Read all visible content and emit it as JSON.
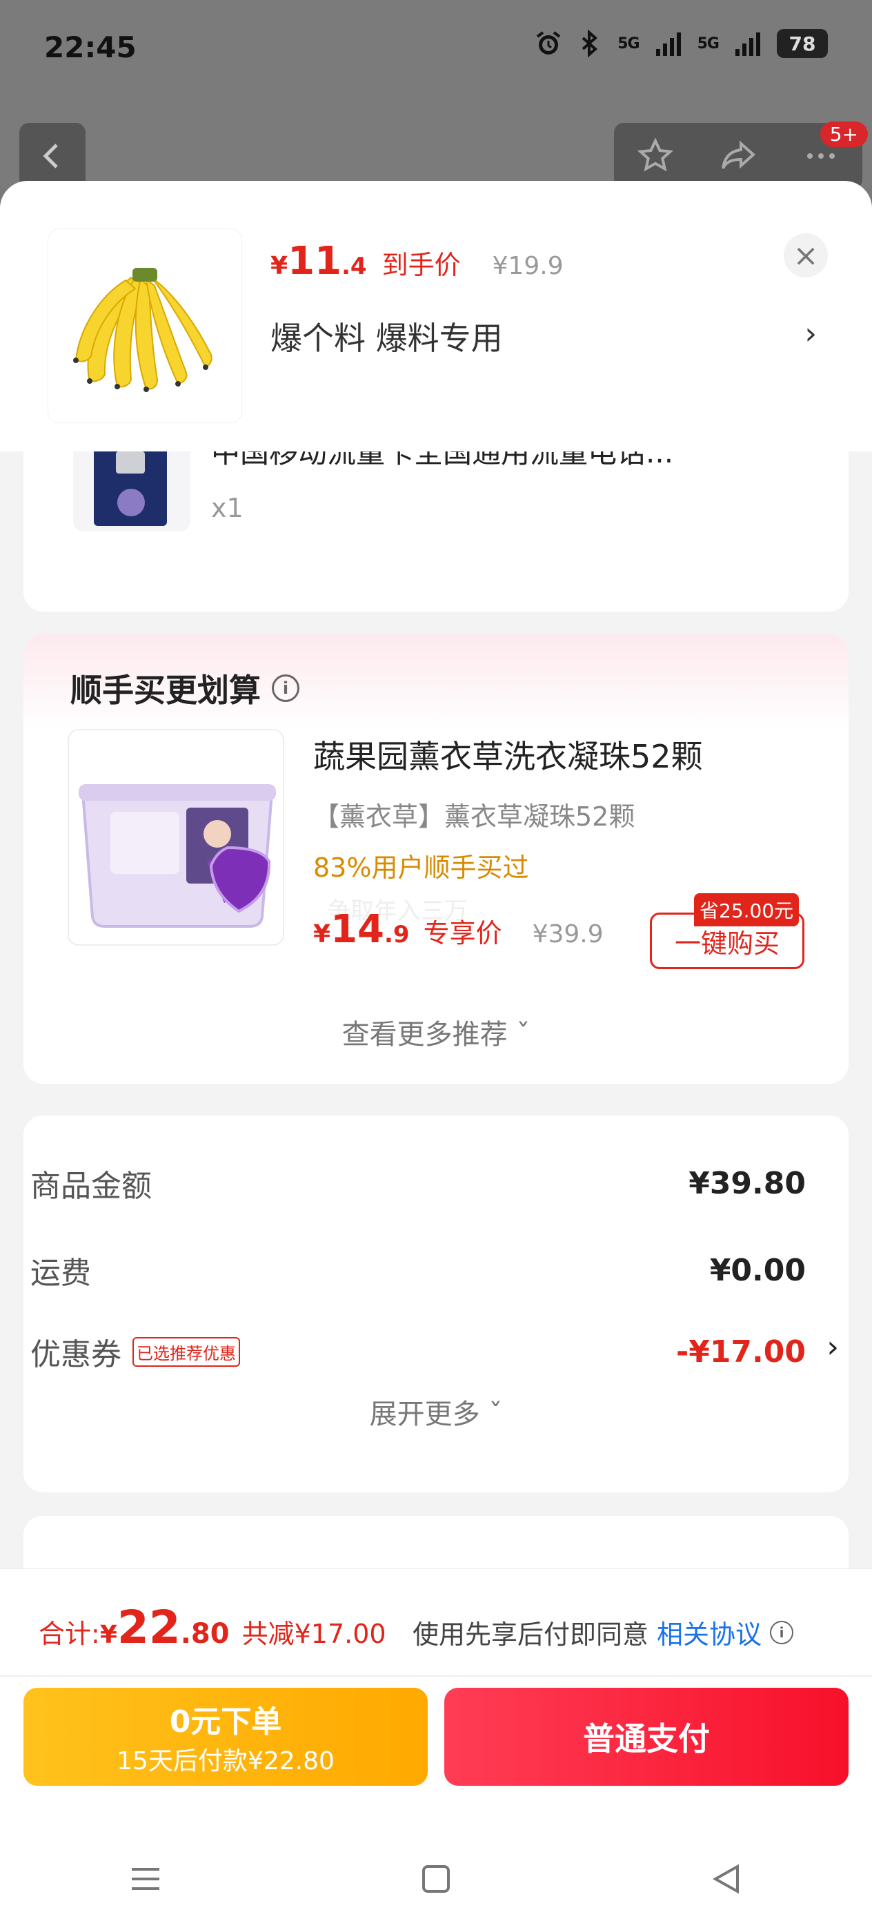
{
  "status_bar": {
    "time": "22:45",
    "signal1": "5G",
    "signal2": "5G",
    "battery": "78"
  },
  "top_nav": {
    "notif_badge": "5+"
  },
  "header": {
    "price_yen": "¥",
    "price_int": "11",
    "price_cents": ".4",
    "price_label": "到手价",
    "original_price": "¥19.9",
    "spec": "爆个料  爆料专用",
    "spec_arrow": "›",
    "close": "×"
  },
  "item": {
    "title": "中国移动流量卡全国通用流量电话...",
    "qty": "x1"
  },
  "recommend": {
    "title": "顺手买更划算",
    "info": "i",
    "product_name": "蔬果园薰衣草洗衣凝珠52颗",
    "product_spec": "【薰衣草】薰衣草凝珠52颗",
    "social_proof": "83%用户顺手买过",
    "ghost_text": "争取年入三万",
    "price_yen": "¥",
    "price_int": "14",
    "price_cents": ".9",
    "price_label": "专享价",
    "original_price": "¥39.9",
    "save_tag": "省25.00元",
    "buy_label": "一键购买",
    "more": "查看更多推荐 ˇ"
  },
  "summary": {
    "rows": [
      {
        "label": "商品金额",
        "value": "¥39.80"
      },
      {
        "label": "运费",
        "value": "¥0.00"
      },
      {
        "label": "优惠券",
        "tag": "已选推荐优惠",
        "value": "-¥17.00"
      }
    ],
    "coupon_arrow": "›",
    "expand": "展开更多 ˇ"
  },
  "bottom": {
    "total_label": "合计: ",
    "total_yen": "¥",
    "total_int": "22",
    "total_cents": ".80",
    "saved": "共减¥17.00",
    "agree_text": "使用先享后付即同意",
    "agree_link": "相关协议",
    "zero_line1": "0元下单",
    "zero_line2": "15天后付款¥22.80",
    "pay_label": "普通支付"
  },
  "colors": {
    "accent_red": "#e1251b",
    "orange": "#ffa900",
    "link_blue": "#1a73e8"
  }
}
